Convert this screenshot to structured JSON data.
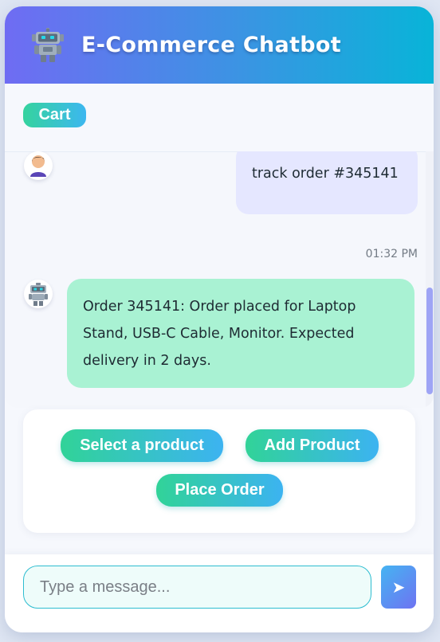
{
  "header": {
    "title": "E-Commerce Chatbot",
    "icon": "robot-icon"
  },
  "toolbar": {
    "cart_label": "Cart"
  },
  "messages": [
    {
      "sender": "user",
      "avatar_icon": "user-avatar-icon",
      "text": "track order #345141",
      "time": "01:32 PM"
    },
    {
      "sender": "bot",
      "avatar_icon": "robot-icon",
      "text": "Order 345141: Order placed for Laptop Stand, USB-C Cable, Monitor. Expected delivery in 2 days."
    }
  ],
  "quick_actions": [
    {
      "label": "Select a product"
    },
    {
      "label": "Add Product"
    },
    {
      "label": "Place Order"
    }
  ],
  "composer": {
    "value": "",
    "placeholder": "Type a message...",
    "send_icon": "send-arrow-icon",
    "send_glyph": "➤"
  },
  "colors": {
    "header_gradient_start": "#6f6cf3",
    "header_gradient_end": "#08b4d8",
    "action_gradient_start": "#31d398",
    "action_gradient_end": "#3cb3f1",
    "user_bubble": "#e5e7ff",
    "bot_bubble": "#a9f2d3",
    "scrollbar_thumb": "#9ea4f5"
  }
}
